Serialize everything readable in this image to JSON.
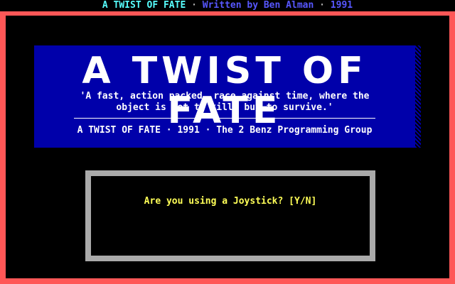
{
  "topbar": {
    "title": "A TWIST OF FATE",
    "separator1": "·",
    "written": "Written by Ben Alman",
    "separator2": "·",
    "year": "1991"
  },
  "banner": {
    "title": "A TWIST OF FATE",
    "tagline": "'A fast, action packed, race against time, where the object is not to kill, but to survive.'",
    "credit": "A TWIST OF FATE · 1991 · The 2 Benz Programming Group"
  },
  "dialog": {
    "prompt": "Are you using a Joystick? [Y/N]"
  },
  "colors": {
    "frame": "#ff5757",
    "banner_bg": "#0000aa",
    "dialog_border": "#aaaaaa",
    "prompt_text": "#ffff57",
    "topbar_title": "#57ffff",
    "topbar_author": "#5757ff"
  }
}
